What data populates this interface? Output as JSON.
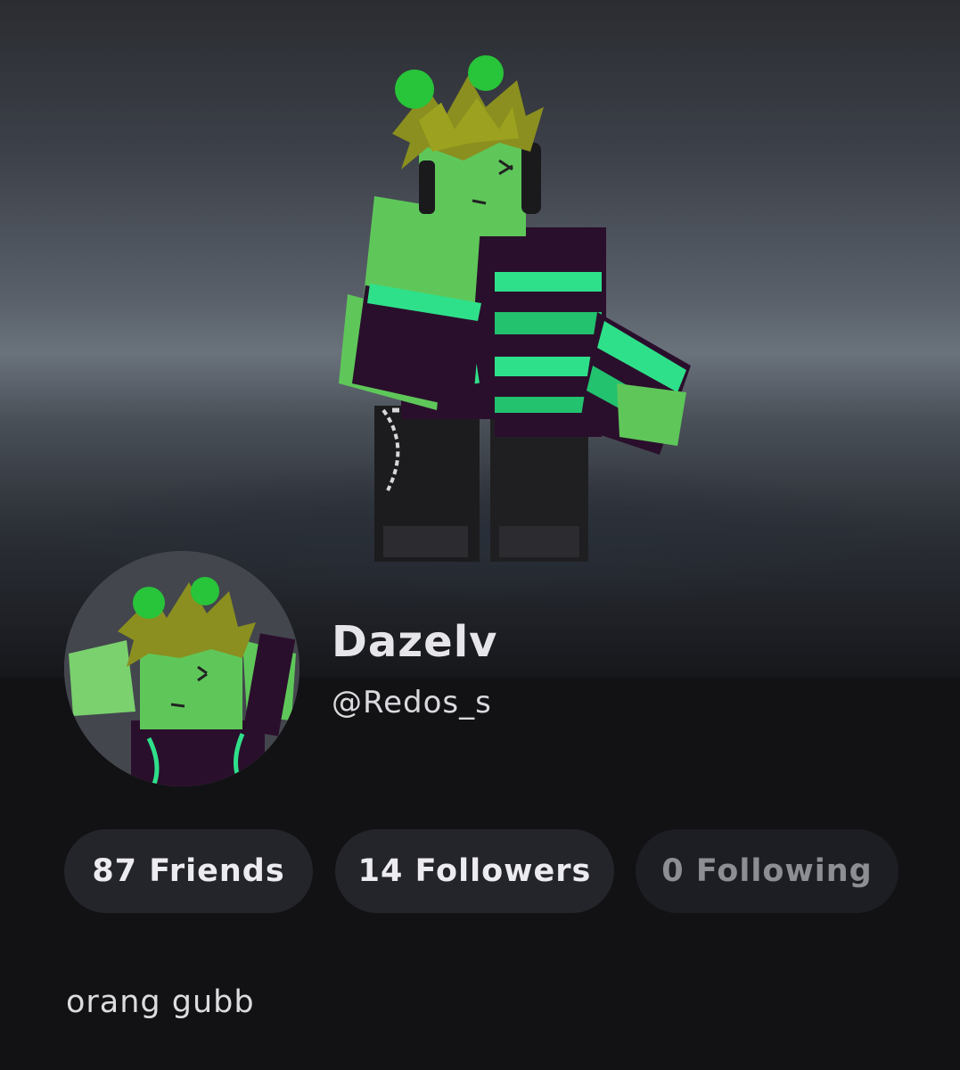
{
  "profile": {
    "display_name": "Dazelv",
    "username": "@Redos_s",
    "bio": "orang gubb"
  },
  "stats": {
    "friends": "87 Friends",
    "followers": "14 Followers",
    "following": "0 Following"
  },
  "colors": {
    "background": "#121215",
    "pill": "#24252b",
    "avatar_green": "#5fc75a",
    "accent_green": "#2fe08a",
    "purple": "#2a0f2c"
  }
}
